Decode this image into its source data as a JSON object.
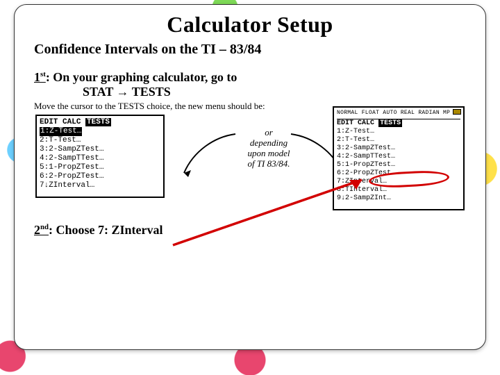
{
  "title": "Calculator Setup",
  "subtitle": "Confidence Intervals on the TI – 83/84",
  "step1": {
    "ord": "1",
    "sup": "st",
    "text_a": ": On your graphing calculator, go to",
    "text_b": "STAT → TESTS"
  },
  "caption": "Move the cursor to the TESTS choice, the new menu should be:",
  "calc_left": {
    "tabs": [
      "EDIT",
      "CALC",
      "TESTS"
    ],
    "items": [
      "1:Z-Test…",
      "2:T-Test…",
      "3:2-SampZTest…",
      "4:2-SampTTest…",
      "5:1-PropZTest…",
      "6:2-PropZTest…",
      "7↓ZInterval…"
    ]
  },
  "or_block": {
    "line1": "or",
    "line2": "depending",
    "line3": "upon model",
    "line4": "of TI 83/84."
  },
  "calc_right": {
    "header": "NORMAL FLOAT AUTO REAL RADIAN MP",
    "tabs": [
      "EDIT",
      "CALC",
      "TESTS"
    ],
    "items": [
      "1:Z-Test…",
      "2:T-Test…",
      "3:2-SampZTest…",
      "4:2-SampTTest…",
      "5:1-PropZTest…",
      "6:2-PropZTest…",
      "7:ZInterval…",
      "8:TInterval…",
      "9↓2-SampZInt…"
    ]
  },
  "step2": {
    "ord": "2",
    "sup": "nd",
    "text": ": Choose 7: ZInterval"
  }
}
